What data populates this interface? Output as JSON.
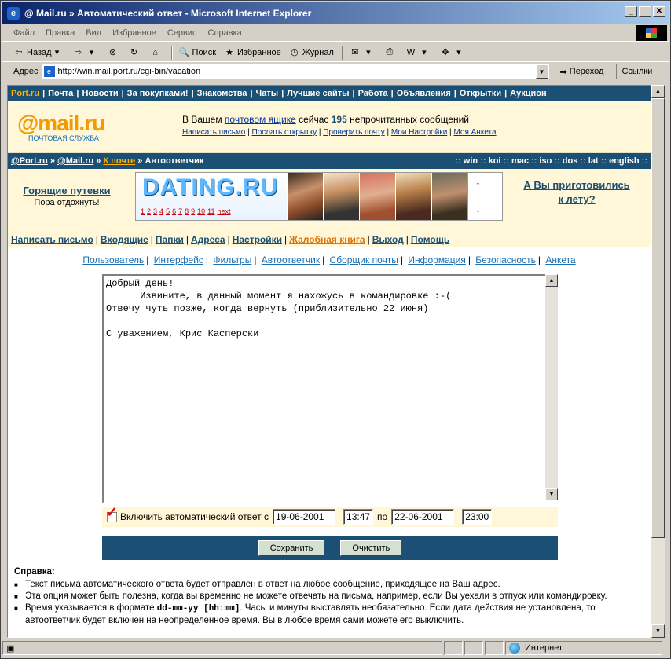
{
  "window": {
    "title": "@ Mail.ru » Автоматический ответ - Microsoft Internet Explorer"
  },
  "menu": [
    "Файл",
    "Правка",
    "Вид",
    "Избранное",
    "Сервис",
    "Справка"
  ],
  "toolbar": {
    "back": "Назад",
    "search": "Поиск",
    "favorites": "Избранное",
    "history": "Журнал"
  },
  "address": {
    "label": "Адрес",
    "url": "http://win.mail.port.ru/cgi-bin/vacation",
    "go": "Переход",
    "links": "Ссылки"
  },
  "portnav": {
    "brand": "Port.ru",
    "items": [
      "Почта",
      "Новости",
      "За покупками!",
      "Знакомства",
      "Чаты",
      "Лучшие сайты",
      "Работа",
      "Объявления",
      "Открытки",
      "Аукцион"
    ]
  },
  "header": {
    "logo": "@mail.ru",
    "logo_sub": "ПОЧТОВАЯ СЛУЖБА",
    "msg_pre": "В Вашем",
    "msg_link": "почтовом ящике",
    "msg_mid": "сейчас",
    "unread": "195",
    "msg_post": "непрочитанных сообщений",
    "links": [
      "Написать письмо",
      "Послать открытку",
      "Проверить почту",
      "Мои Настройки",
      "Моя Анкета"
    ]
  },
  "breadcrumb": {
    "port": "@Port.ru",
    "mail": "@Mail.ru",
    "inbox": "К почте",
    "current": "Автоответчик",
    "langs": [
      "win",
      "koi",
      "mac",
      "iso",
      "dos",
      "lat",
      "english"
    ]
  },
  "ads": {
    "hot_title": "Горящие путевки",
    "hot_sub": "Пора отдохнуть!",
    "dating": "DATING.RU",
    "pages": [
      "1",
      "2",
      "3",
      "4",
      "5",
      "6",
      "7",
      "8",
      "9",
      "10",
      "11",
      "next"
    ],
    "ready_line1": "А Вы приготовились",
    "ready_line2": "к лету?"
  },
  "mailmenu": [
    "Написать письмо",
    "Входящие",
    "Папки",
    "Адреса",
    "Настройки",
    "Жалобная книга",
    "Выход",
    "Помощь"
  ],
  "settings_tabs": [
    "Пользователь",
    "Интерфейс",
    "Фильтры",
    "Автоответчик",
    "Сборщик почты",
    "Информация",
    "Безопасность",
    "Анкета"
  ],
  "form": {
    "message": "Добрый день!\n      Извините, в данный момент я нахожусь в командировке :-(\nОтвечу чуть позже, когда вернуть (приблизительно 22 июня)\n\nС уважением, Крис Касперски",
    "enable_label": "Включить автоматический ответ с",
    "enabled": true,
    "from_date": "19-06-2001",
    "from_time": "13:47",
    "to_label": "по",
    "to_date": "22-06-2001",
    "to_time": "23:00",
    "save": "Сохранить",
    "clear": "Очистить"
  },
  "help": {
    "title": "Справка:",
    "item1": "Текст письма автоматического ответа будет отправлен в ответ на любое сообщение, приходящее на Ваш адрес.",
    "item2": "Эта опция может быть полезна, когда вы временно не можете отвечать на письма, например, если Вы уехали в отпуск или командировку.",
    "item3_pre": "Время указывается в формате",
    "item3_code": "dd-mm-yy [hh:mm]",
    "item3_post": ". Часы и минуты выставлять необязательно. Если дата действия не установлена, то автоответчик будет включен на неопределенное время. Вы в любое время сами можете его выключить."
  },
  "status": {
    "zone": "Интернет"
  }
}
